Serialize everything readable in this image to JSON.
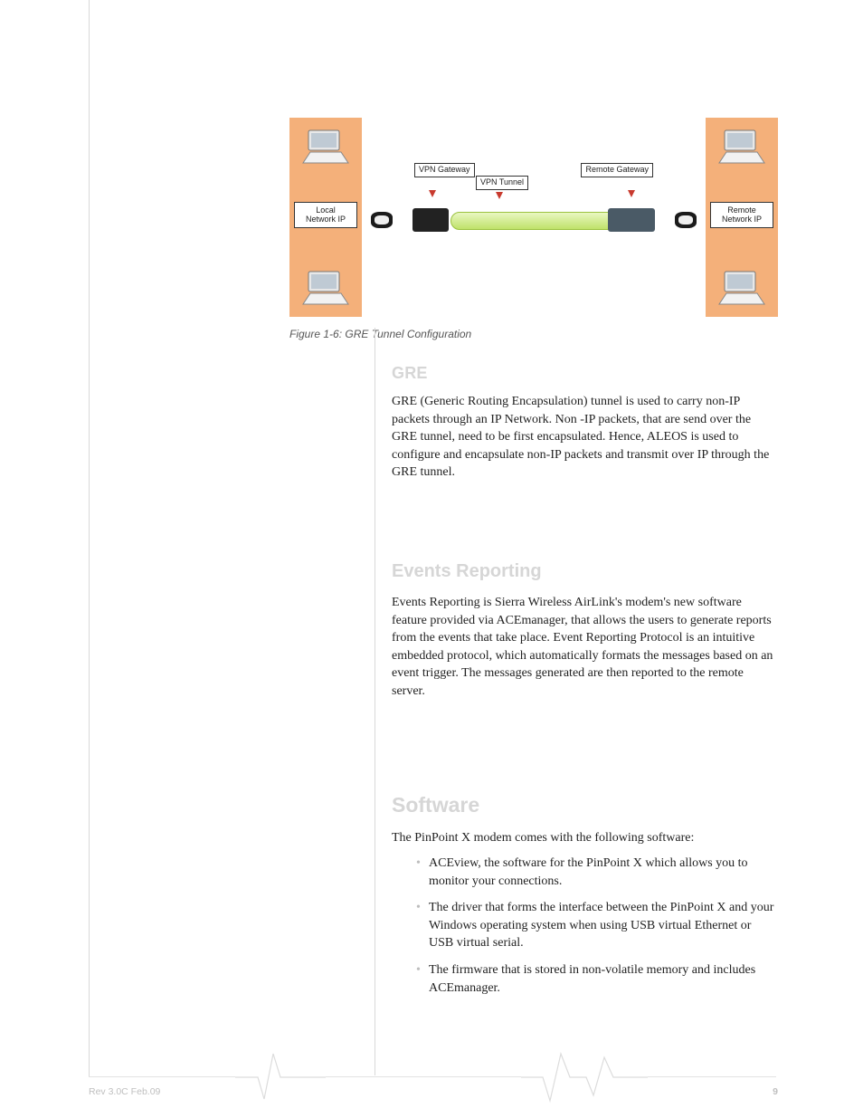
{
  "diagram": {
    "local_ip_label": "Local\nNetwork IP",
    "remote_ip_label": "Remote\nNetwork IP",
    "vpn_gateway_label": "VPN\nGateway",
    "vpn_tunnel_label": "VPN Tunnel",
    "remote_gateway_label": "Remote\nGateway"
  },
  "figure_caption": "Figure 1-6: GRE Tunnel Configuration",
  "headings": {
    "gre": "GRE",
    "events": "Events Reporting",
    "software": "Software"
  },
  "paragraphs": {
    "gre": "GRE (Generic Routing Encapsulation) tunnel is used to carry non-IP packets through an IP Network. Non -IP packets, that are send over the GRE tunnel, need to be first encapsulated. Hence, ALEOS is used to configure and encapsulate non-IP packets and transmit over IP through the GRE tunnel.",
    "events": "Events Reporting is Sierra Wireless AirLink's  modem's new software feature provided via ACEmanager, that allows the users to generate reports from the events that take place. Event Reporting Protocol is an intuitive embedded protocol, which automatically formats the messages based on an event trigger. The messages generated are then reported to the remote server.",
    "software_intro": "The PinPoint X modem comes with the following software:"
  },
  "software_bullets": [
    "ACEview, the software for the PinPoint X which allows you to monitor your connections.",
    "The driver that forms the interface between the PinPoint X and your Windows operating system  when using USB virtual Ethernet or USB virtual serial.",
    "The firmware that is stored in non-volatile memory and includes ACEmanager."
  ],
  "footer": {
    "rev": "Rev 3.0C  Feb.09",
    "date": "",
    "page": "9"
  }
}
